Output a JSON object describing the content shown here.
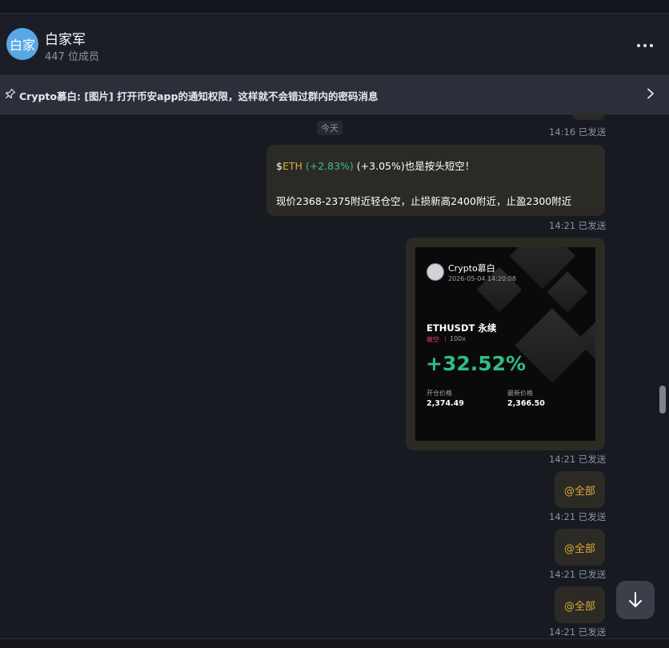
{
  "chat": {
    "title": "白家军",
    "avatar_text": "白家",
    "member_count": "447 位成员"
  },
  "pinned": {
    "text": "Crypto慕白: [图片] 打开币安app的通知权限，这样就不会错过群内的密码消息"
  },
  "date_chip": "今天",
  "messages": [
    {
      "meta": "14:16 已发送"
    },
    {
      "line1": {
        "prefix": "$",
        "symbol": "ETH",
        "pct": " (+2.83%)",
        "rest": " (+3.05%)也是按头短空！"
      },
      "line2": "现价2368-2375附近轻仓空，止损新高2400附近，止盈2300附近",
      "meta": "14:21 已发送"
    },
    {
      "card": {
        "user": "Crypto慕白",
        "datetime": "2026-05-04 14:20:08",
        "pair": "ETHUSDT 永续",
        "side": "做空",
        "separator": "|",
        "leverage": "100x",
        "pnl": "+32.52%",
        "open_label": "开仓价格",
        "open_value": "2,374.49",
        "last_label": "最新价格",
        "last_value": "2,366.50"
      },
      "meta": "14:21 已发送"
    },
    {
      "text": "@全部",
      "meta": "14:21 已发送"
    },
    {
      "text": "@全部",
      "meta": "14:21 已发送"
    },
    {
      "text": "@全部",
      "meta": "14:21 已发送"
    }
  ],
  "icons": {
    "menu": "more-vertical-dots-icon",
    "pin": "pin-icon",
    "chevron": "chevron-right-icon",
    "scroll_down": "arrow-down-icon"
  },
  "colors": {
    "background": "#171a21",
    "bubble": "#2b2a25",
    "accent_gold": "#e0a93a",
    "positive_green": "#3fbf87",
    "short_red": "#e24a5a"
  }
}
